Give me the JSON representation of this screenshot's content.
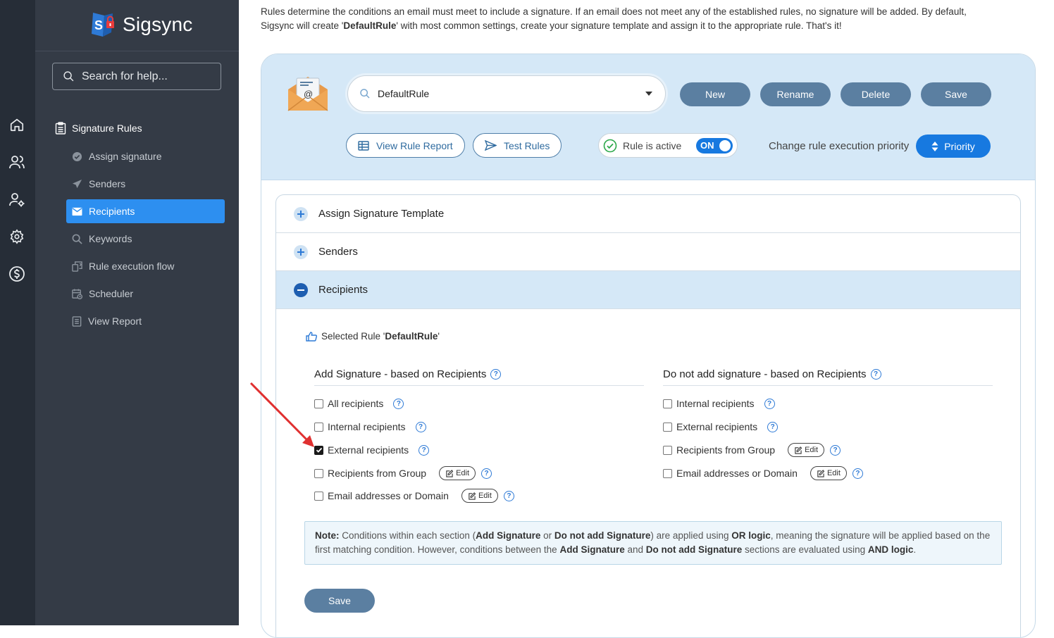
{
  "brand": {
    "name": "Sigsync"
  },
  "sidebar": {
    "search_placeholder": "Search for help...",
    "section": "Signature Rules",
    "items": [
      {
        "label": "Assign signature"
      },
      {
        "label": "Senders"
      },
      {
        "label": "Recipients",
        "active": true
      },
      {
        "label": "Keywords"
      },
      {
        "label": "Rule execution flow"
      },
      {
        "label": "Scheduler"
      },
      {
        "label": "View Report"
      }
    ]
  },
  "intro": {
    "p1": "Rules determine the conditions an email must meet to include a signature. If an email does not meet any of the established rules, no signature will be added. By default,",
    "p2a": "Sigsync will create '",
    "p2b": "DefaultRule",
    "p2c": "' with most common settings, create your signature template and assign it to the appropriate rule. That's it!"
  },
  "toolbar": {
    "rule_value": "DefaultRule",
    "new": "New",
    "rename": "Rename",
    "delete": "Delete",
    "save": "Save",
    "view_report": "View Rule Report",
    "test_rules": "Test Rules",
    "rule_active": "Rule is active",
    "toggle": "ON",
    "priority_label": "Change rule execution priority",
    "priority_btn": "Priority"
  },
  "accordion": {
    "assign": "Assign Signature Template",
    "senders": "Senders",
    "recipients": "Recipients"
  },
  "selected_rule": {
    "prefix": "Selected Rule '",
    "name": "DefaultRule",
    "suffix": "'"
  },
  "add_section": {
    "title": "Add Signature - based on Recipients",
    "options": [
      {
        "label": "All recipients",
        "checked": false
      },
      {
        "label": "Internal recipients",
        "checked": false
      },
      {
        "label": "External recipients",
        "checked": true
      },
      {
        "label": "Recipients from Group",
        "checked": false,
        "edit": "Edit"
      },
      {
        "label": "Email addresses or Domain",
        "checked": false,
        "edit": "Edit"
      }
    ]
  },
  "noadd_section": {
    "title": "Do not add signature - based on Recipients",
    "options": [
      {
        "label": "Internal recipients",
        "checked": false
      },
      {
        "label": "External recipients",
        "checked": false
      },
      {
        "label": "Recipients from Group",
        "checked": false,
        "edit": "Edit"
      },
      {
        "label": "Email addresses or Domain",
        "checked": false,
        "edit": "Edit"
      }
    ]
  },
  "note": {
    "b1": "Note:",
    "t1": " Conditions within each section (",
    "b2": "Add Signature",
    "t2": " or ",
    "b3": "Do not add Signature",
    "t3": ") are applied using ",
    "b4": "OR logic",
    "t4": ", meaning the signature will be applied based on the first matching condition. However, conditions between the ",
    "b5": "Add Signature",
    "t5": " and ",
    "b6": "Do not add Signature",
    "t6": " sections are evaluated using ",
    "b7": "AND logic",
    "t7": "."
  },
  "save_label": "Save",
  "colors": {
    "accent": "#1779e0",
    "active_nav": "#2d8ff0",
    "sidebar": "#343b46",
    "rail": "#262d37",
    "annotation": "#e03030"
  }
}
